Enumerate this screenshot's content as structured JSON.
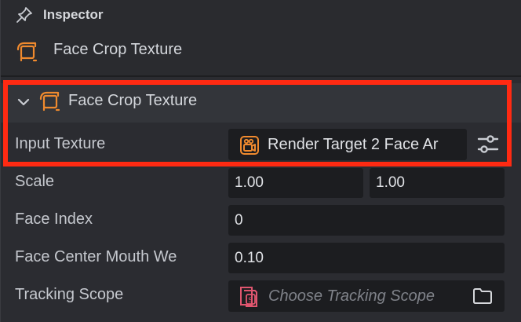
{
  "header": {
    "title": "Inspector",
    "pin_icon": "pin-icon"
  },
  "object": {
    "name": "Face Crop Texture",
    "icon": "face-crop-icon"
  },
  "component": {
    "title": "Face Crop Texture",
    "icon": "face-crop-icon",
    "expanded": true,
    "properties": {
      "input_texture": {
        "label": "Input Texture",
        "value": "Render Target 2 Face Ar",
        "icon": "render-target-icon",
        "settings_icon": "sliders-icon"
      },
      "scale": {
        "label": "Scale",
        "x": "1.00",
        "y": "1.00"
      },
      "face_index": {
        "label": "Face Index",
        "value": "0"
      },
      "face_center_mouth_weight": {
        "label": "Face Center Mouth We",
        "value": "0.10"
      },
      "tracking_scope": {
        "label": "Tracking Scope",
        "placeholder": "Choose Tracking Scope",
        "icon": "script-icon",
        "folder_icon": "folder-icon"
      }
    }
  },
  "colors": {
    "accent": "#f08a2e",
    "highlight": "#ff2a12",
    "script_pink": "#e0566f"
  }
}
